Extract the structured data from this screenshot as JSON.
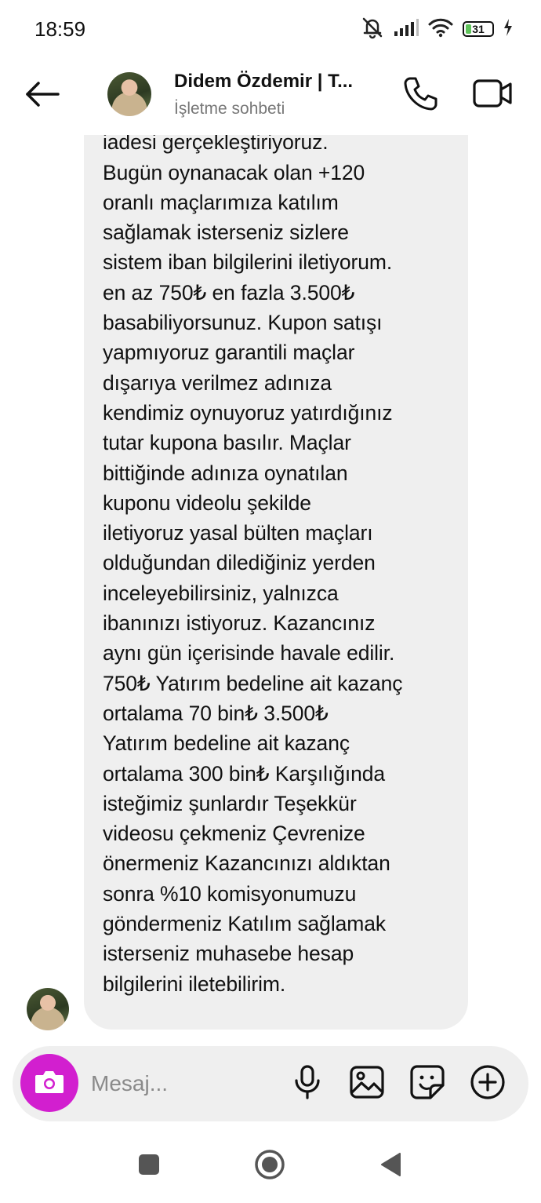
{
  "status_bar": {
    "time": "18:59",
    "battery_level": "31",
    "icons": [
      "mute-icon",
      "signal-icon",
      "wifi-icon",
      "battery-icon",
      "charging-icon"
    ]
  },
  "header": {
    "back_icon": "arrow-left-icon",
    "contact_name": "Didem Özdemir | T...",
    "subtitle": "İşletme sohbeti",
    "call_icon": "phone-icon",
    "video_icon": "video-camera-icon"
  },
  "message": {
    "text": "Kuponunuz kaybederse para\niadesi gerçekleştiriyoruz.\nBugün oynanacak olan +120\noranlı maçlarımıza katılım\nsağlamak isterseniz sizlere\nsistem iban bilgilerini iletiyorum.\nen az 750₺ en fazla 3.500₺\nbasabiliyorsunuz. Kupon satışı\nyapmıyoruz garantili maçlar\ndışarıya verilmez adınıza\nkendimiz oynuyoruz yatırdığınız\ntutar kupona basılır. Maçlar\nbittiğinde adınıza oynatılan\nkuponu videolu şekilde\niletiyoruz yasal bülten maçları\nolduğundan dilediğiniz yerden\ninceleyebilirsiniz, yalnızca\nibanınızı istiyoruz. Kazancınız\naynı gün içerisinde havale edilir.\n750₺ Yatırım bedeline ait kazanç\nortalama 70 bin₺   3.500₺\nYatırım bedeline ait kazanç\nortalama 300 bin₺   Karşılığında\nisteğimiz şunlardır  Teşekkür\nvideosu çekmeniz  Çevrenize\nönermeniz  Kazancınızı aldıktan\nsonra %10 komisyonumuzu\ngöndermeniz Katılım sağlamak\nisterseniz muhasebe hesap\nbilgilerini iletebilirim."
  },
  "composer": {
    "placeholder": "Mesaj...",
    "camera_icon": "camera-icon",
    "mic_icon": "microphone-icon",
    "gallery_icon": "image-icon",
    "sticker_icon": "sticker-icon",
    "plus_icon": "plus-circle-icon"
  },
  "nav": {
    "recents_icon": "square-icon",
    "home_icon": "circle-home-icon",
    "back_icon": "triangle-back-icon"
  },
  "colors": {
    "accent": "#d21fcf",
    "bubble": "#efefef",
    "subtitle": "#777777"
  }
}
